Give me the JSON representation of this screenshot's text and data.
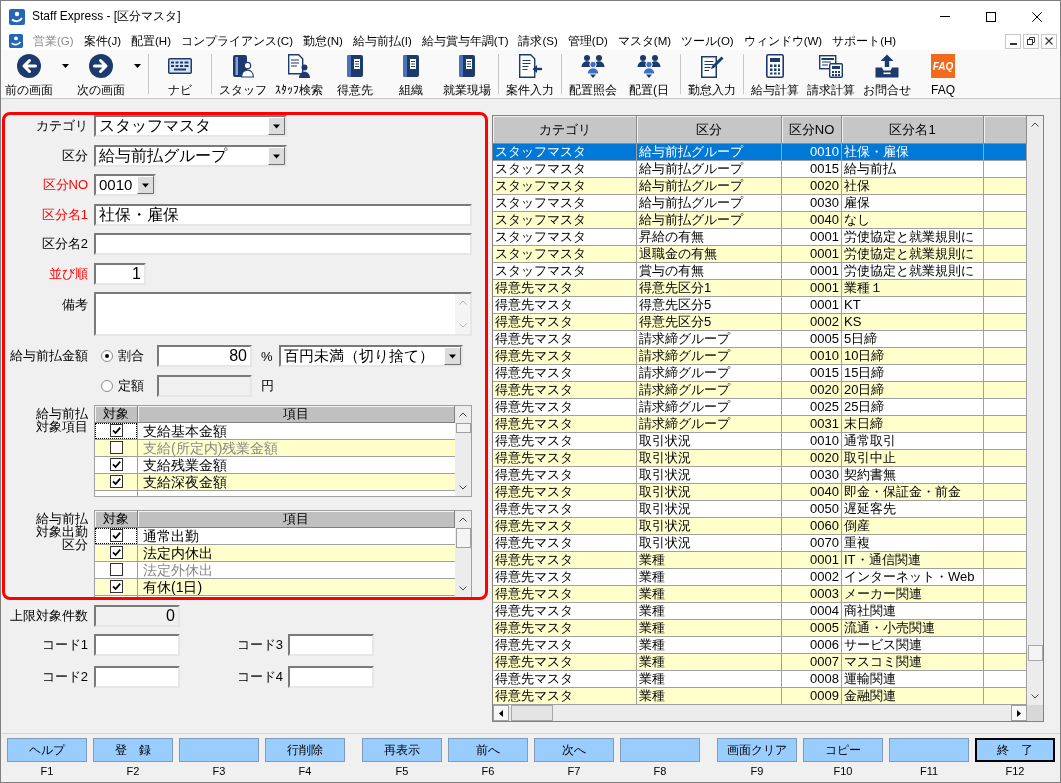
{
  "window": {
    "title": "Staff Express - [区分マスタ]"
  },
  "menu": [
    {
      "label": "営業(G)",
      "disabled": true
    },
    {
      "label": "案件(J)",
      "disabled": false
    },
    {
      "label": "配置(H)",
      "disabled": false
    },
    {
      "label": "コンプライアンス(C)",
      "disabled": false
    },
    {
      "label": "勤怠(N)",
      "disabled": false
    },
    {
      "label": "給与前払(I)",
      "disabled": false
    },
    {
      "label": "給与賞与年調(T)",
      "disabled": false
    },
    {
      "label": "請求(S)",
      "disabled": false
    },
    {
      "label": "管理(D)",
      "disabled": false
    },
    {
      "label": "マスタ(M)",
      "disabled": false
    },
    {
      "label": "ツール(O)",
      "disabled": false
    },
    {
      "label": "ウィンドウ(W)",
      "disabled": false
    },
    {
      "label": "サポート(H)",
      "disabled": false
    }
  ],
  "toolbar": [
    {
      "buttons": [
        {
          "label": "前の画面",
          "dropdown": true
        },
        {
          "label": "次の画面",
          "dropdown": true
        }
      ]
    },
    {
      "buttons": [
        {
          "label": "ナビ",
          "dropdown": false
        }
      ]
    },
    {
      "buttons": [
        {
          "label": "スタッフ",
          "dropdown": false
        },
        {
          "label": "ｽﾀｯﾌ検索",
          "dropdown": false
        },
        {
          "label": "得意先",
          "dropdown": false
        },
        {
          "label": "組織",
          "dropdown": false
        },
        {
          "label": "就業現場",
          "dropdown": false
        }
      ]
    },
    {
      "buttons": [
        {
          "label": "案件入力",
          "dropdown": false
        }
      ]
    },
    {
      "buttons": [
        {
          "label": "配置照会",
          "dropdown": false
        },
        {
          "label": "配置(日",
          "dropdown": false
        }
      ]
    },
    {
      "buttons": [
        {
          "label": "勤怠入力",
          "dropdown": false
        }
      ]
    },
    {
      "buttons": [
        {
          "label": "給与計算",
          "dropdown": false
        },
        {
          "label": "請求計算",
          "dropdown": false
        },
        {
          "label": "お問合せ",
          "dropdown": false
        },
        {
          "label": "FAQ",
          "dropdown": false,
          "tile_text": "FAQ"
        }
      ]
    }
  ],
  "form": {
    "fields": [
      {
        "kind": "select",
        "label": "カテゴリ",
        "value": "スタッフマスタ",
        "required": false
      },
      {
        "kind": "select",
        "label": "区分",
        "value": "給与前払グループ",
        "required": false
      },
      {
        "kind": "code_select",
        "label": "区分NO",
        "value": "0010",
        "required": true
      },
      {
        "kind": "text",
        "label": "区分名1",
        "value": "社保・雇保",
        "required": true
      },
      {
        "kind": "text",
        "label": "区分名2",
        "required": false
      },
      {
        "kind": "number",
        "label": "並び順",
        "value": "1",
        "required": true
      },
      {
        "kind": "textarea",
        "label": "備考",
        "required": false
      }
    ],
    "advance_amount": {
      "label": "給与前払金額",
      "options": [
        {
          "label": "割合",
          "selected": true,
          "value": "80",
          "unit": "%",
          "rounding": "百円未満（切り捨て）"
        },
        {
          "label": "定額",
          "selected": false,
          "unit": "円"
        }
      ]
    },
    "grids": [
      {
        "label": "給与前払対象項目",
        "columns": [
          "対象",
          "項目"
        ],
        "rows": [
          {
            "label": "支給基本金額",
            "checked": true,
            "focused": true
          },
          {
            "label": "支給(所定内)残業金額",
            "checked": false,
            "focused": false
          },
          {
            "label": "支給残業金額",
            "checked": true,
            "focused": false
          },
          {
            "label": "支給深夜金額",
            "checked": true,
            "focused": false
          }
        ]
      },
      {
        "label": "給与前払対象出勤区分",
        "columns": [
          "対象",
          "項目"
        ],
        "rows": [
          {
            "label": "通常出勤",
            "checked": true,
            "focused": true
          },
          {
            "label": "法定内休出",
            "checked": true,
            "focused": false
          },
          {
            "label": "法定外休出",
            "checked": false,
            "focused": false
          },
          {
            "label": "有休(1日)",
            "checked": true,
            "focused": false
          }
        ]
      }
    ],
    "limit": {
      "label": "上限対象件数",
      "value": "0"
    },
    "codes": [
      {
        "label": "コード1"
      },
      {
        "label": "コード3"
      },
      {
        "label": "コード2"
      },
      {
        "label": "コード4"
      }
    ]
  },
  "table": {
    "columns": [
      "カテゴリ",
      "区分",
      "区分NO",
      "区分名1"
    ],
    "rows": [
      {
        "cells": [
          "スタッフマスタ",
          "給与前払グループ",
          "0010",
          "社保・雇保"
        ],
        "selected": true
      },
      {
        "cells": [
          "スタッフマスタ",
          "給与前払グループ",
          "0015",
          "給与前払"
        ],
        "selected": false
      },
      {
        "cells": [
          "スタッフマスタ",
          "給与前払グループ",
          "0020",
          "社保"
        ],
        "selected": false
      },
      {
        "cells": [
          "スタッフマスタ",
          "給与前払グループ",
          "0030",
          "雇保"
        ],
        "selected": false
      },
      {
        "cells": [
          "スタッフマスタ",
          "給与前払グループ",
          "0040",
          "なし"
        ],
        "selected": false
      },
      {
        "cells": [
          "スタッフマスタ",
          "昇給の有無",
          "0001",
          "労使協定と就業規則に"
        ],
        "selected": false
      },
      {
        "cells": [
          "スタッフマスタ",
          "退職金の有無",
          "0001",
          "労使協定と就業規則に"
        ],
        "selected": false
      },
      {
        "cells": [
          "スタッフマスタ",
          "賞与の有無",
          "0001",
          "労使協定と就業規則に"
        ],
        "selected": false
      },
      {
        "cells": [
          "得意先マスタ",
          "得意先区分1",
          "0001",
          "業種１"
        ],
        "selected": false
      },
      {
        "cells": [
          "得意先マスタ",
          "得意先区分5",
          "0001",
          "KT"
        ],
        "selected": false
      },
      {
        "cells": [
          "得意先マスタ",
          "得意先区分5",
          "0002",
          "KS"
        ],
        "selected": false
      },
      {
        "cells": [
          "得意先マスタ",
          "請求締グループ",
          "0005",
          "5日締"
        ],
        "selected": false
      },
      {
        "cells": [
          "得意先マスタ",
          "請求締グループ",
          "0010",
          "10日締"
        ],
        "selected": false
      },
      {
        "cells": [
          "得意先マスタ",
          "請求締グループ",
          "0015",
          "15日締"
        ],
        "selected": false
      },
      {
        "cells": [
          "得意先マスタ",
          "請求締グループ",
          "0020",
          "20日締"
        ],
        "selected": false
      },
      {
        "cells": [
          "得意先マスタ",
          "請求締グループ",
          "0025",
          "25日締"
        ],
        "selected": false
      },
      {
        "cells": [
          "得意先マスタ",
          "請求締グループ",
          "0031",
          "末日締"
        ],
        "selected": false
      },
      {
        "cells": [
          "得意先マスタ",
          "取引状況",
          "0010",
          "通常取引"
        ],
        "selected": false
      },
      {
        "cells": [
          "得意先マスタ",
          "取引状況",
          "0020",
          "取引中止"
        ],
        "selected": false
      },
      {
        "cells": [
          "得意先マスタ",
          "取引状況",
          "0030",
          "契約書無"
        ],
        "selected": false
      },
      {
        "cells": [
          "得意先マスタ",
          "取引状況",
          "0040",
          "即金・保証金・前金"
        ],
        "selected": false
      },
      {
        "cells": [
          "得意先マスタ",
          "取引状況",
          "0050",
          "遅延客先"
        ],
        "selected": false
      },
      {
        "cells": [
          "得意先マスタ",
          "取引状況",
          "0060",
          "倒産"
        ],
        "selected": false
      },
      {
        "cells": [
          "得意先マスタ",
          "取引状況",
          "0070",
          "重複"
        ],
        "selected": false
      },
      {
        "cells": [
          "得意先マスタ",
          "業種",
          "0001",
          "IT・通信関連"
        ],
        "selected": false
      },
      {
        "cells": [
          "得意先マスタ",
          "業種",
          "0002",
          "インターネット・Web"
        ],
        "selected": false
      },
      {
        "cells": [
          "得意先マスタ",
          "業種",
          "0003",
          "メーカー関連"
        ],
        "selected": false
      },
      {
        "cells": [
          "得意先マスタ",
          "業種",
          "0004",
          "商社関連"
        ],
        "selected": false
      },
      {
        "cells": [
          "得意先マスタ",
          "業種",
          "0005",
          "流通・小売関連"
        ],
        "selected": false
      },
      {
        "cells": [
          "得意先マスタ",
          "業種",
          "0006",
          "サービス関連"
        ],
        "selected": false
      },
      {
        "cells": [
          "得意先マスタ",
          "業種",
          "0007",
          "マスコミ関連"
        ],
        "selected": false
      },
      {
        "cells": [
          "得意先マスタ",
          "業種",
          "0008",
          "運輸関連"
        ],
        "selected": false
      },
      {
        "cells": [
          "得意先マスタ",
          "業種",
          "0009",
          "金融関連"
        ],
        "selected": false
      }
    ]
  },
  "function_keys": [
    {
      "keys": [
        {
          "label": "ヘルプ",
          "key": "F1",
          "default": false
        },
        {
          "label": "登　録",
          "key": "F2",
          "default": false
        },
        {
          "key": "F3",
          "default": false
        },
        {
          "label": "行削除",
          "key": "F4",
          "default": false
        }
      ]
    },
    {
      "keys": [
        {
          "label": "再表示",
          "key": "F5",
          "default": false
        },
        {
          "label": "前へ",
          "key": "F6",
          "default": false
        },
        {
          "label": "次へ",
          "key": "F7",
          "default": false
        },
        {
          "key": "F8",
          "default": false
        }
      ]
    },
    {
      "keys": [
        {
          "label": "画面クリア",
          "key": "F9",
          "default": false
        },
        {
          "label": "コピー",
          "key": "F10",
          "default": false
        },
        {
          "key": "F11",
          "default": false
        },
        {
          "label": "終　了",
          "key": "F12",
          "default": true
        }
      ]
    }
  ]
}
